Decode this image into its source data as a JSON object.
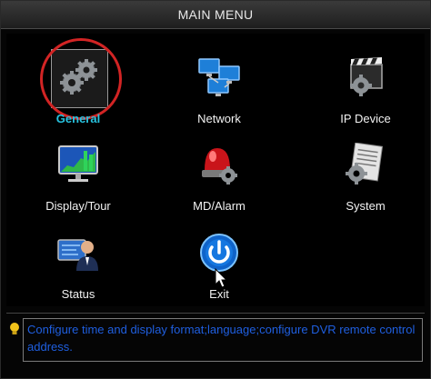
{
  "window": {
    "title": "MAIN MENU"
  },
  "menu": {
    "general": {
      "label": "General"
    },
    "network": {
      "label": "Network"
    },
    "ip_device": {
      "label": "IP Device"
    },
    "display_tour": {
      "label": "Display/Tour"
    },
    "md_alarm": {
      "label": "MD/Alarm"
    },
    "system": {
      "label": "System"
    },
    "status": {
      "label": "Status"
    },
    "exit": {
      "label": "Exit"
    }
  },
  "hint": {
    "text": "Configure time and display format;language;configure DVR remote control address."
  },
  "colors": {
    "selected_label": "#27c3e0",
    "hint_text": "#1f5fe0",
    "selection_ring": "#d22424"
  }
}
